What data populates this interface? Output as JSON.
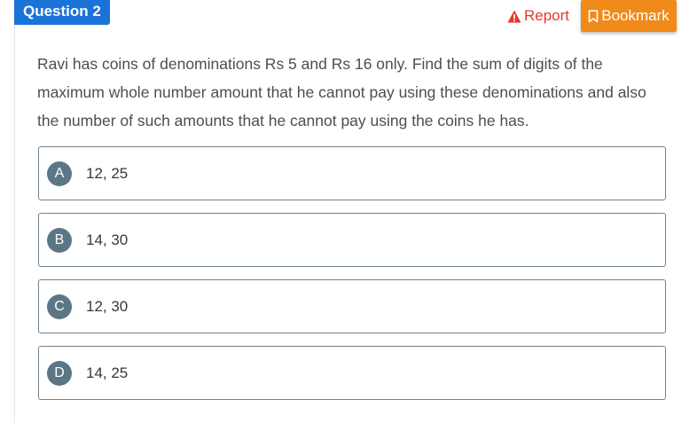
{
  "header": {
    "question_label": "Question 2",
    "report_label": "Report",
    "bookmark_label": "Bookmark",
    "report_color": "#e5392b",
    "bookmark_color": "#f08a1a",
    "question_badge_color": "#1a73d9"
  },
  "question": {
    "text": "Ravi has coins of denominations Rs 5 and Rs 16 only. Find the sum of digits of the maximum whole number amount that he cannot pay using these denominations and also the number of such amounts that he cannot pay using the coins he has."
  },
  "options": [
    {
      "letter": "A",
      "text": "12, 25"
    },
    {
      "letter": "B",
      "text": "14, 30"
    },
    {
      "letter": "C",
      "text": "12, 30"
    },
    {
      "letter": "D",
      "text": "14, 25"
    }
  ],
  "icons": {
    "report": "warning-triangle-icon",
    "bookmark": "bookmark-icon"
  }
}
